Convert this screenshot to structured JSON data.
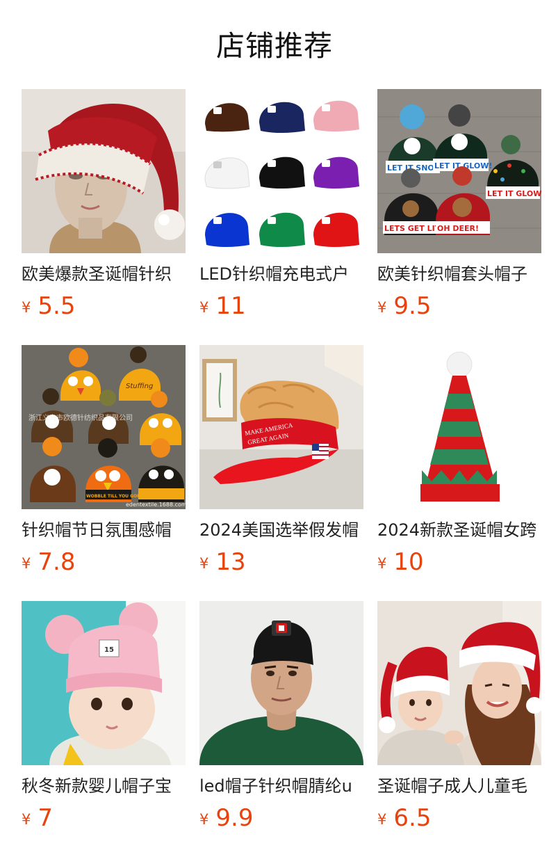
{
  "section_title": "店铺推荐",
  "currency_symbol": "¥",
  "products": [
    {
      "name": "欧美爆款圣诞帽针织",
      "price": "5.5",
      "image_icon": "santa-hat-mannequin"
    },
    {
      "name": "LED针织帽充电式户",
      "price": "11",
      "image_icon": "led-beanies-grid"
    },
    {
      "name": "欧美针织帽套头帽子",
      "price": "9.5",
      "image_icon": "christmas-beanies",
      "image_text": [
        "LET IT SNOW",
        "LET IT GLOW!",
        "LET IT GLOW!",
        "LETS GET LIT",
        "OH DEER!"
      ]
    },
    {
      "name": "针织帽节日氛围感帽",
      "price": "7.8",
      "image_icon": "turkey-beanies",
      "image_text": [
        "浙江义乌市欧德针纺织品有限公司",
        "edentextile.1688.com",
        "WOBBLE TILL YOU GOBBLE",
        "Stuffing"
      ]
    },
    {
      "name": "2024美国选举假发帽",
      "price": "13",
      "image_icon": "wig-visor-cap",
      "image_text": [
        "MAKE AMERICA",
        "GREAT AGAIN"
      ]
    },
    {
      "name": "2024新款圣诞帽女跨",
      "price": "10",
      "image_icon": "elf-hat"
    },
    {
      "name": "秋冬新款婴儿帽子宝",
      "price": "7",
      "image_icon": "baby-pink-hat",
      "image_text": [
        "15"
      ]
    },
    {
      "name": "led帽子针织帽腈纶u",
      "price": "9.9",
      "image_icon": "man-led-beanie"
    },
    {
      "name": "圣诞帽子成人儿童毛",
      "price": "6.5",
      "image_icon": "mother-child-santa-hats"
    }
  ],
  "colors": {
    "price": "#e8430c",
    "title": "#111111",
    "name": "#222222",
    "background": "#ffffff"
  }
}
